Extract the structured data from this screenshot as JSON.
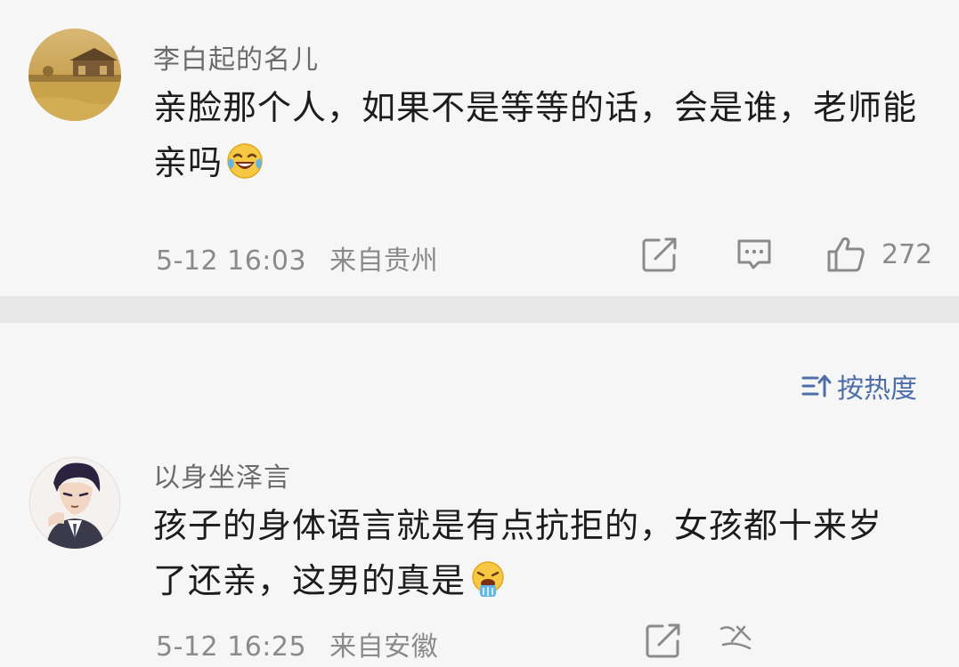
{
  "comments": [
    {
      "username": "李白起的名儿",
      "text_line1": "亲脸那个人，如果不是等等的话，会是谁，老师能",
      "text_line2": "亲吗",
      "emoji": "laughing-tears-emoji",
      "date": "5-12 16:03",
      "location": "来自贵州",
      "likes": "272"
    },
    {
      "username": "以身坐泽言",
      "text_line1": "孩子的身体语言就是有点抗拒的，女孩都十来岁",
      "text_line2": "了还亲，这男的真是",
      "emoji": "vomit-emoji",
      "date": "5-12 16:25",
      "location": "来自安徽"
    }
  ],
  "sort": {
    "label": "按热度",
    "icon": "sort-icon"
  },
  "icons": {
    "share": "share-icon",
    "reply": "comment-icon",
    "like": "thumbs-up-icon"
  },
  "colors": {
    "sort_text": "#4d6ea8",
    "meta_text": "#8a8a8a",
    "divider": "#e8e8e8"
  }
}
